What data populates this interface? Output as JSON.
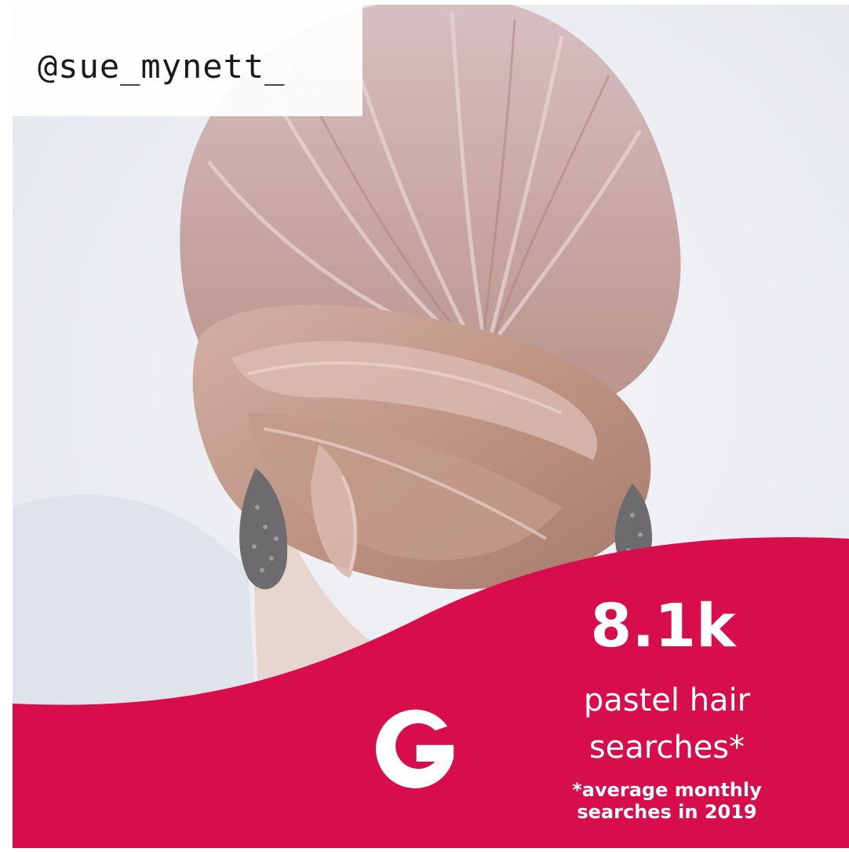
{
  "overlay": {
    "handle": "@sue_mynett_"
  },
  "stat": {
    "value": "8.1k",
    "label": "pastel hair searches*",
    "footnote": "*average monthly searches in 2019"
  },
  "logo": {
    "icon": "google-g-icon"
  },
  "colors": {
    "banner": "#d80d4c",
    "text_on_banner": "#ffffff",
    "background": "#eef0f3"
  }
}
